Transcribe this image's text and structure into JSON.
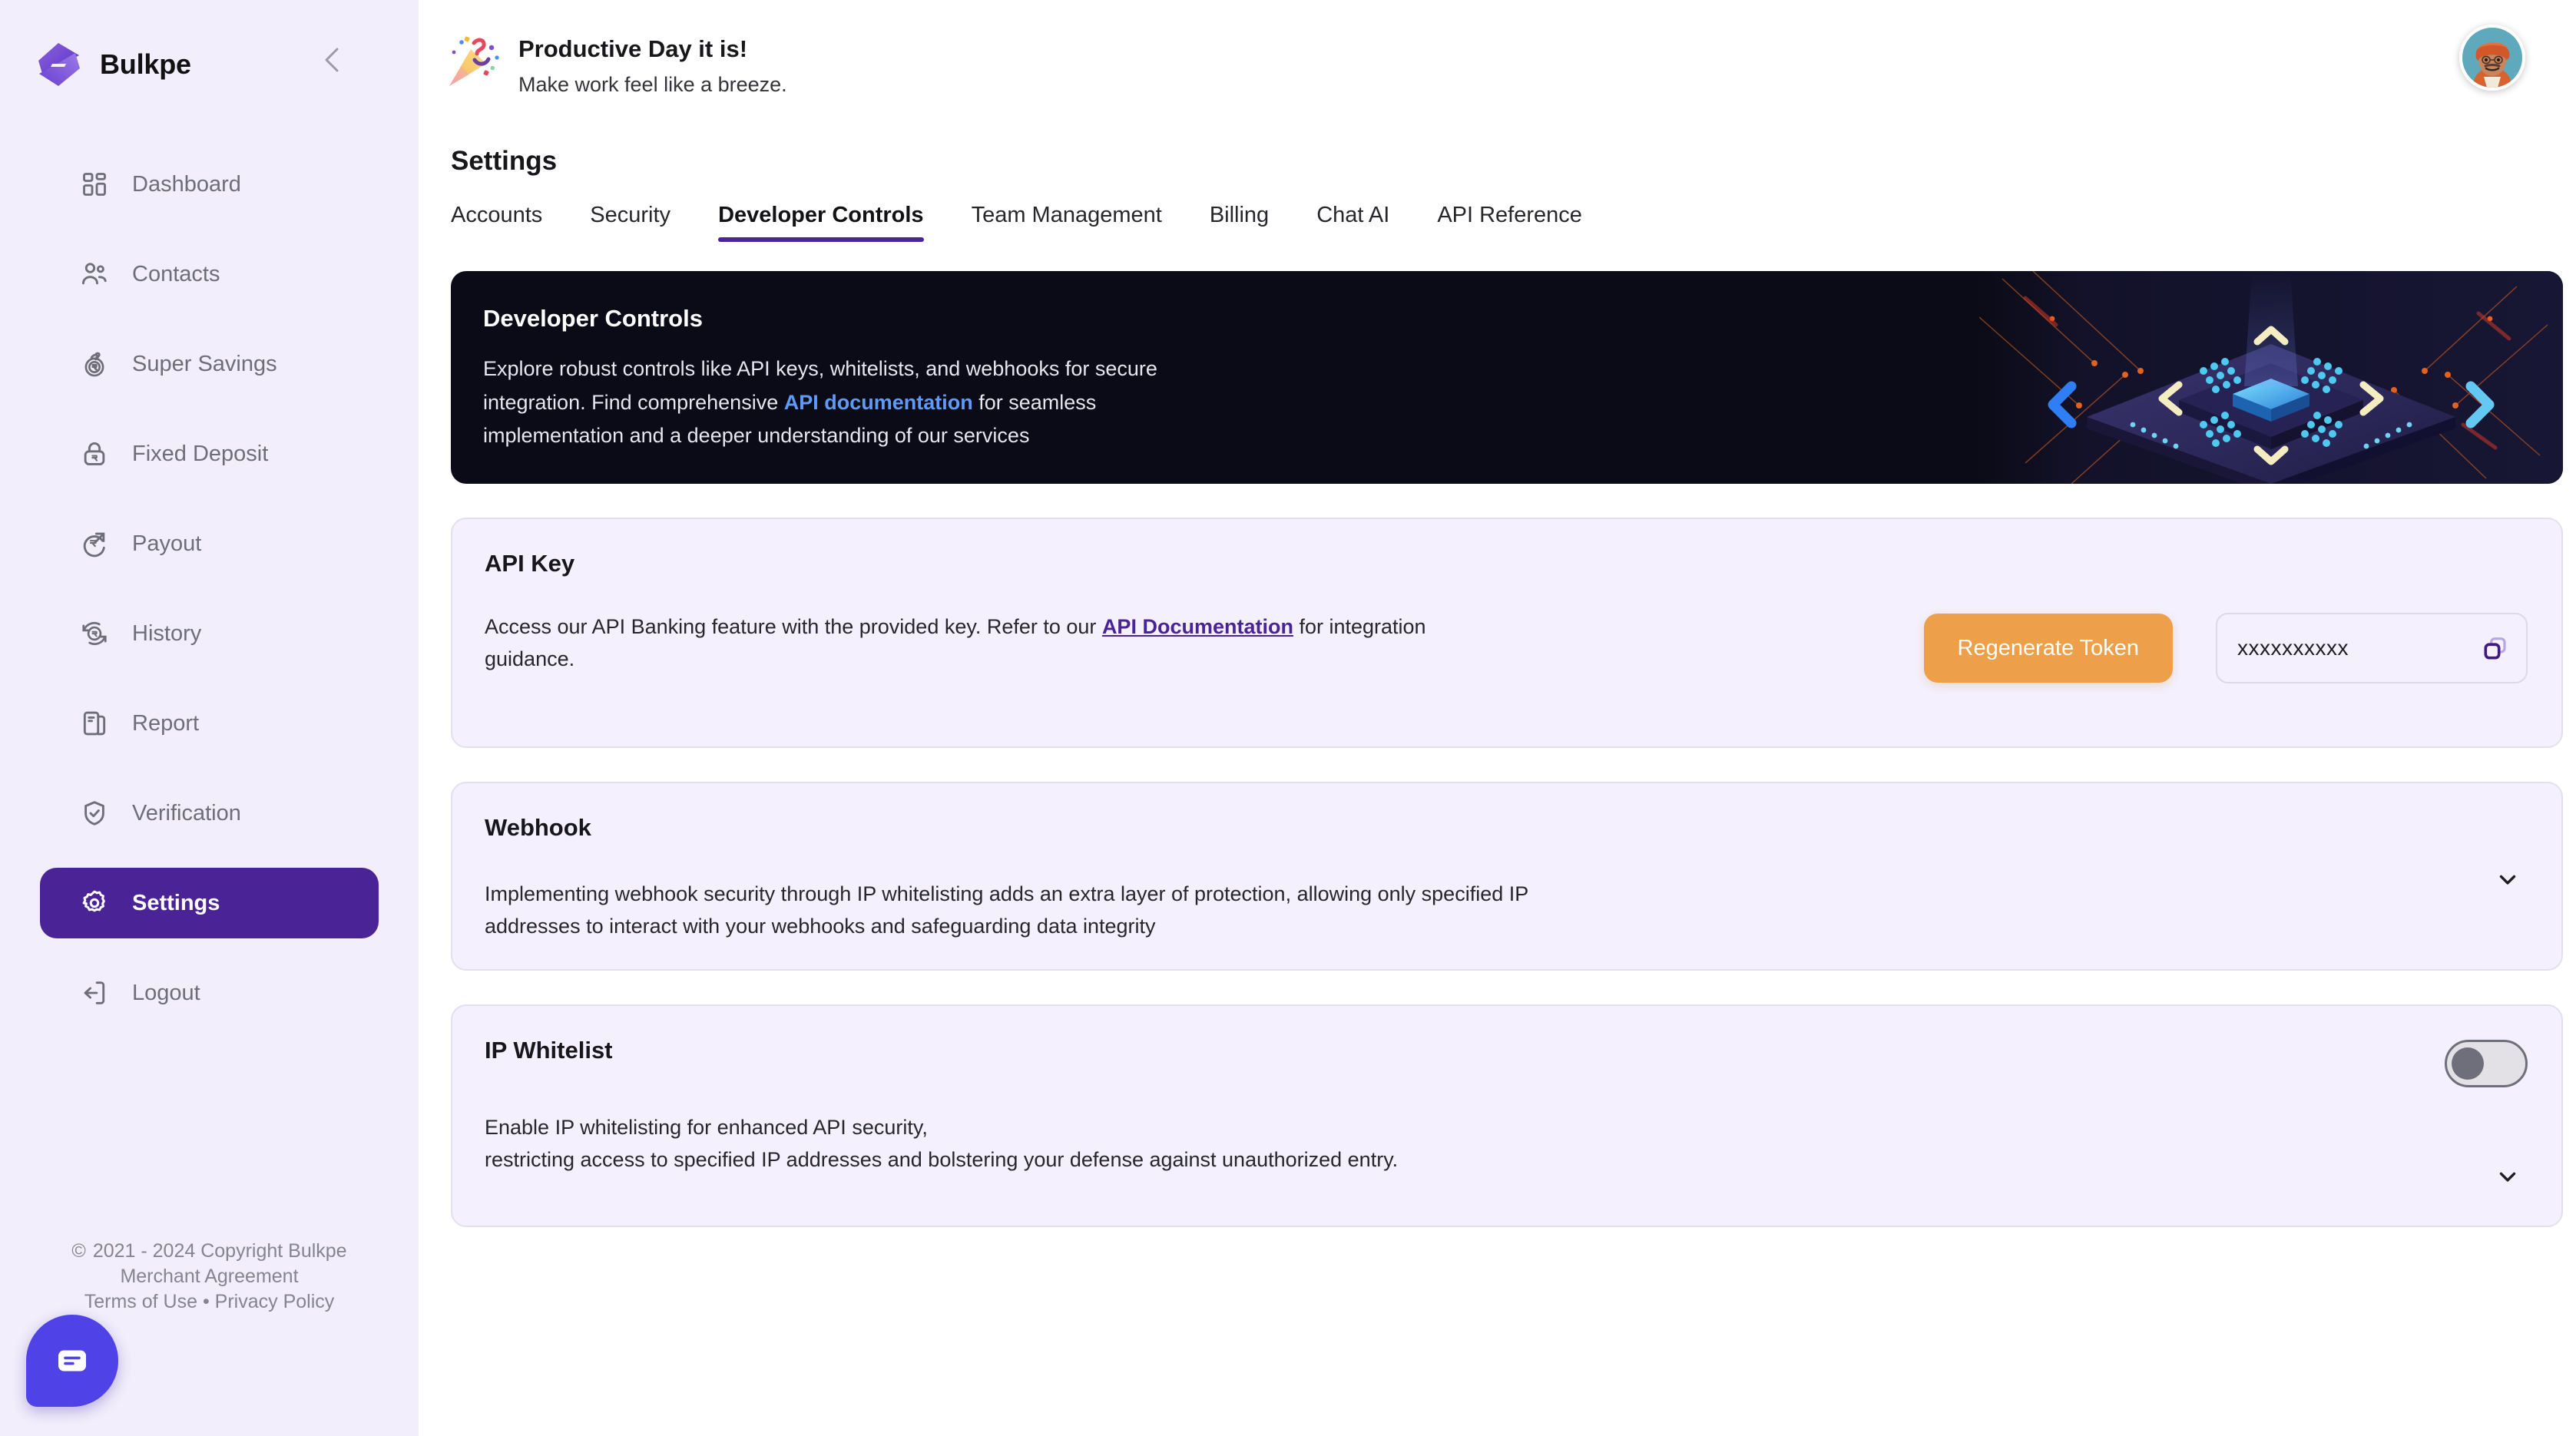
{
  "brand": {
    "name": "Bulkpe",
    "logo_icon": "bulkpe-logo-icon",
    "collapse_icon": "chevron-left-icon"
  },
  "sidebar": {
    "items": [
      {
        "label": "Dashboard",
        "icon": "grid-icon",
        "active": false
      },
      {
        "label": "Contacts",
        "icon": "users-icon",
        "active": false
      },
      {
        "label": "Super Savings",
        "icon": "savings-bag-icon",
        "active": false
      },
      {
        "label": "Fixed Deposit",
        "icon": "lock-rupee-icon",
        "active": false
      },
      {
        "label": "Payout",
        "icon": "payout-arrow-icon",
        "active": false
      },
      {
        "label": "History",
        "icon": "history-icon",
        "active": false
      },
      {
        "label": "Report",
        "icon": "report-doc-icon",
        "active": false
      },
      {
        "label": "Verification",
        "icon": "shield-check-icon",
        "active": false
      },
      {
        "label": "Settings",
        "icon": "gear-icon",
        "active": true
      },
      {
        "label": "Logout",
        "icon": "logout-icon",
        "active": false
      }
    ],
    "footer": {
      "copyright_symbol": "©",
      "copyright": "2021 - 2024 Copyright Bulkpe",
      "merchant_agreement": "Merchant Agreement",
      "terms": "Terms of Use",
      "separator": "•",
      "privacy": "Privacy Policy"
    },
    "chat_icon": "chat-bubble-icon"
  },
  "header": {
    "emoji_icon": "party-popper-icon",
    "title": "Productive Day it is!",
    "subtitle": "Make work feel like a breeze.",
    "avatar_icon": "user-avatar"
  },
  "settings": {
    "page_title": "Settings",
    "tabs": [
      {
        "label": "Accounts",
        "active": false
      },
      {
        "label": "Security",
        "active": false
      },
      {
        "label": "Developer Controls",
        "active": true
      },
      {
        "label": "Team Management",
        "active": false
      },
      {
        "label": "Billing",
        "active": false
      },
      {
        "label": "Chat AI",
        "active": false
      },
      {
        "label": "API  Reference",
        "active": false
      }
    ]
  },
  "banner": {
    "title": "Developer Controls",
    "text_before": "Explore robust controls like API keys, whitelists, and webhooks for secure integration. Find comprehensive ",
    "link": "API documentation",
    "text_after": " for seamless implementation and a deeper understanding of our services",
    "art_icon": "isometric-chip-illustration"
  },
  "api_key": {
    "title": "API Key",
    "desc_before": "Access our API Banking feature with the provided key. Refer to our ",
    "desc_link": "API Documentation",
    "desc_after": " for integration guidance.",
    "regenerate_label": "Regenerate Token",
    "key_value": "xxxxxxxxxx",
    "key_placeholder": "xxxxxxxxxx",
    "copy_icon": "copy-icon"
  },
  "webhook": {
    "title": "Webhook",
    "desc": "Implementing webhook security through IP whitelisting adds an extra layer of protection, allowing only specified IP addresses to interact with your webhooks and safeguarding data integrity",
    "expand_icon": "chevron-down-icon"
  },
  "ip_whitelist": {
    "title": "IP Whitelist",
    "desc_line1": "Enable IP whitelisting for enhanced API security,",
    "desc_line2": "restricting access to specified IP addresses and bolstering your defense against unauthorized entry.",
    "toggle_state": "off",
    "expand_icon": "chevron-down-icon"
  },
  "colors": {
    "brand_purple": "#4a2496",
    "sidebar_bg": "#f2eefb",
    "card_bg": "#f4f0fd",
    "banner_bg": "#0b0b17",
    "accent_orange": "#eda049",
    "link_blue": "#5f9bf5",
    "chat_purple": "#4f43e8"
  }
}
